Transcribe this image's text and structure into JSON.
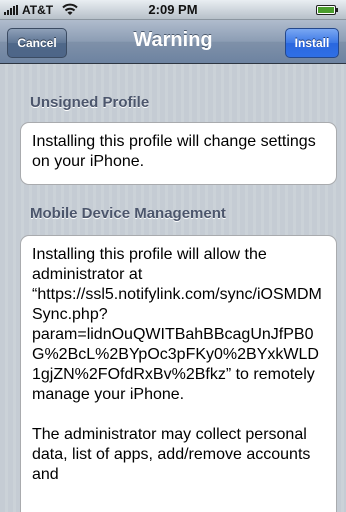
{
  "status_bar": {
    "carrier": "AT&T",
    "time": "2:09 PM"
  },
  "nav_bar": {
    "title": "Warning",
    "cancel_label": "Cancel",
    "install_label": "Install"
  },
  "sections": [
    {
      "header": "Unsigned Profile",
      "body": [
        "Installing this profile will change settings on your iPhone."
      ]
    },
    {
      "header": "Mobile Device Management",
      "body": [
        "Installing this profile will allow the administrator at “https://ssl5.notifylink.com/sync/iOSMDMSync.php?param=lidnOuQWITBahBBcagUnJfPB0G%2BcL%2BYpOc3pFKy0%2BYxkWLD1gjZN%2FOfdRxBv%2Bfkz” to remotely manage your iPhone.",
        "The administrator may collect personal data, list of apps, add/remove accounts and"
      ]
    }
  ],
  "colors": {
    "background": "#c5ccd4",
    "nav_bar": "#6d83a1",
    "install_button": "#2f6fe5",
    "section_header": "#4c566c"
  },
  "icons": [
    "signal-icon",
    "wifi-icon",
    "battery-icon"
  ]
}
